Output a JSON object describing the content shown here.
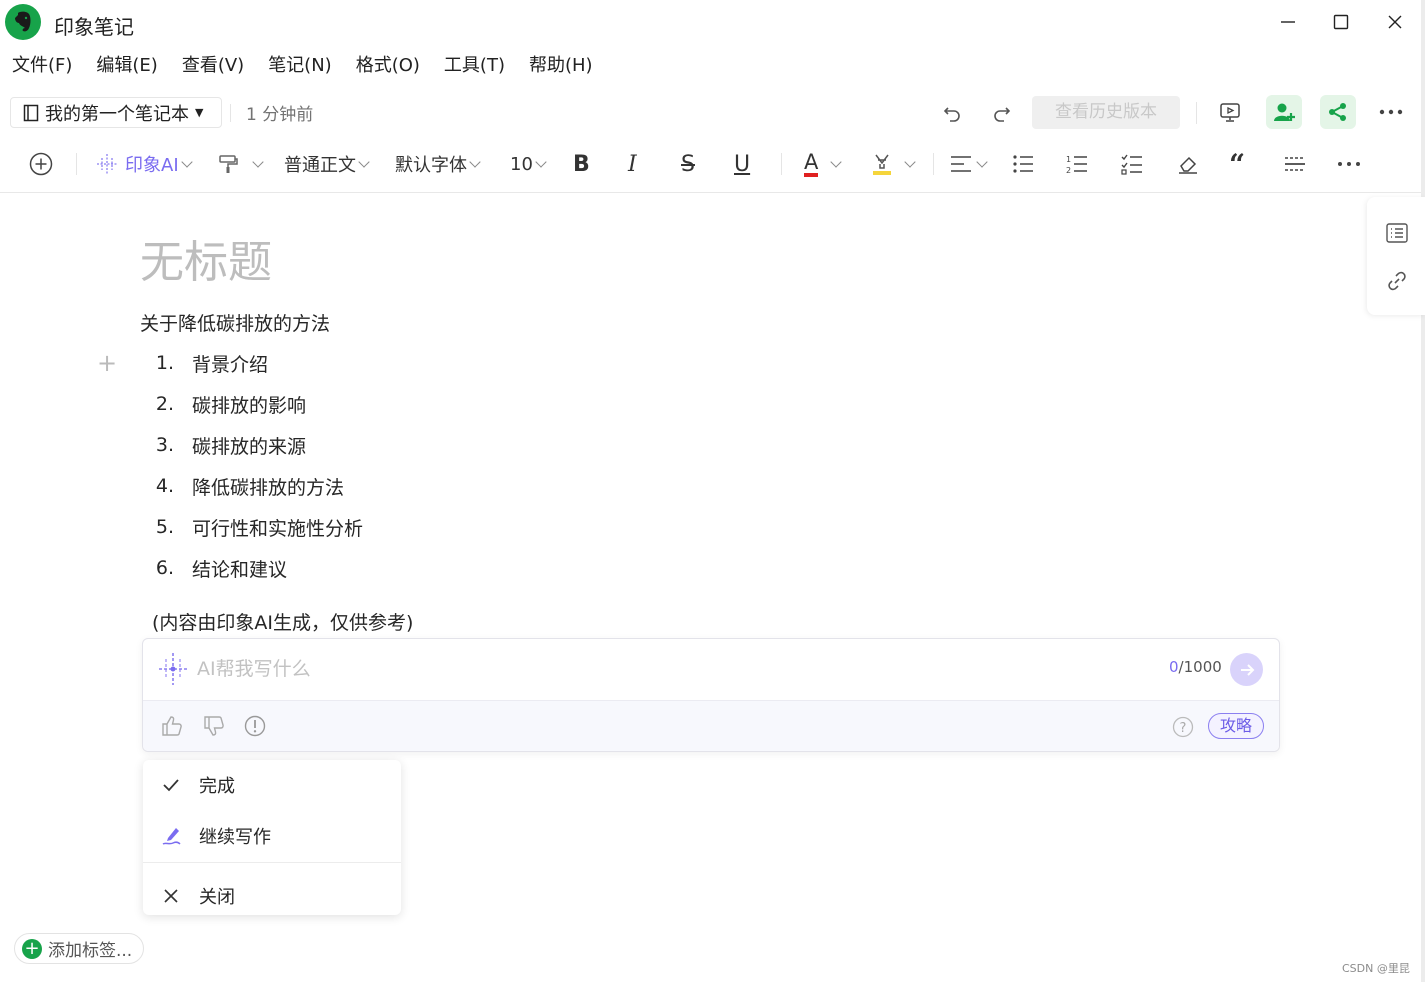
{
  "window": {
    "app_title": "印象笔记"
  },
  "menu": [
    "文件(F)",
    "编辑(E)",
    "查看(V)",
    "笔记(N)",
    "格式(O)",
    "工具(T)",
    "帮助(H)"
  ],
  "notebar": {
    "notebook": "我的第一个笔记本",
    "updated": "1 分钟前",
    "history_button": "查看历史版本"
  },
  "toolbar": {
    "ai_label": "印象AI",
    "paragraph_style": "普通正文",
    "font": "默认字体",
    "font_size": "10",
    "bold": "B",
    "italic": "I",
    "strikethrough": "S",
    "underline": "U",
    "text_color": "A",
    "quote": "“",
    "more": "···"
  },
  "note": {
    "title": "无标题",
    "intro": "关于降低碳排放的方法",
    "items": [
      {
        "num": "1.",
        "text": "背景介绍"
      },
      {
        "num": "2.",
        "text": "碳排放的影响"
      },
      {
        "num": "3.",
        "text": "碳排放的来源"
      },
      {
        "num": "4.",
        "text": "降低碳排放的方法"
      },
      {
        "num": "5.",
        "text": "可行性和实施性分析"
      },
      {
        "num": "6.",
        "text": "结论和建议"
      }
    ],
    "disclaimer": "(内容由印象AI生成，仅供参考)"
  },
  "ai_panel": {
    "placeholder": "AI帮我写什么",
    "counter_current": "0",
    "counter_max": "/1000",
    "guide_button": "攻略"
  },
  "ai_menu": {
    "done": "完成",
    "continue": "继续写作",
    "close": "关闭"
  },
  "footer": {
    "add_tag": "添加标签...",
    "watermark": "CSDN @里昆"
  },
  "colors": {
    "brand_green": "#17a34a",
    "ai_purple": "#7a6cf0",
    "text_color_red": "#e02020",
    "highlight_yellow": "#f5d53b"
  }
}
